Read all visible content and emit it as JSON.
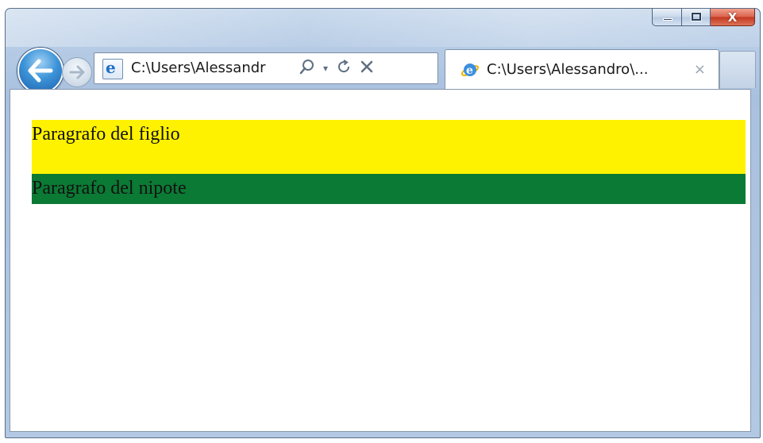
{
  "window": {
    "caption_buttons": {
      "minimize_icon": "minimize-icon",
      "maximize_icon": "maximize-icon",
      "close_label": "X"
    }
  },
  "navigation": {
    "back_icon": "back-arrow-icon",
    "forward_icon": "forward-arrow-icon"
  },
  "address_bar": {
    "url": "C:\\Users\\Alessandr",
    "search_icon": "search-icon",
    "dropdown_icon": "dropdown-arrow-icon",
    "refresh_icon": "refresh-icon",
    "stop_icon": "stop-icon"
  },
  "tab": {
    "title": "C:\\Users\\Alessandro\\...",
    "close_label": "×"
  },
  "page": {
    "paragraph_child": "Paragrafo del figlio",
    "paragraph_grandchild": "Paragrafo del nipote",
    "colors": {
      "child_bg": "#fff200",
      "grandchild_bg": "#0b7a34"
    }
  }
}
